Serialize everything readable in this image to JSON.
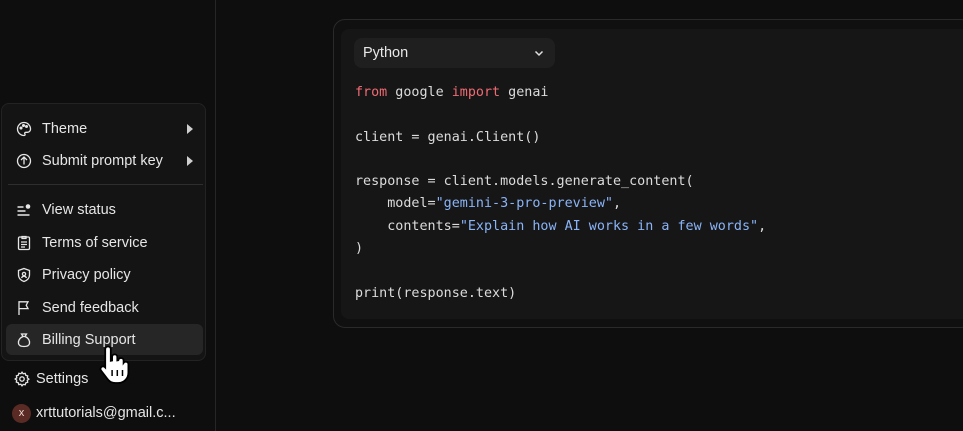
{
  "menu": {
    "items": [
      {
        "label": "Theme",
        "icon": "palette-icon",
        "submenu": true
      },
      {
        "label": "Submit prompt key",
        "icon": "arrow-up-circle-icon",
        "submenu": true
      },
      {
        "label": "View status",
        "icon": "status-icon",
        "submenu": false
      },
      {
        "label": "Terms of service",
        "icon": "document-icon",
        "submenu": false
      },
      {
        "label": "Privacy policy",
        "icon": "shield-icon",
        "submenu": false
      },
      {
        "label": "Send feedback",
        "icon": "flag-icon",
        "submenu": false
      },
      {
        "label": "Billing Support",
        "icon": "money-bag-icon",
        "submenu": false
      }
    ]
  },
  "settings": {
    "label": "Settings",
    "icon": "gear-icon"
  },
  "account": {
    "avatar_letter": "x",
    "email": "xrttutorials@gmail.c..."
  },
  "code_panel": {
    "language": "Python",
    "lines": [
      [
        {
          "t": "from",
          "c": "kw"
        },
        {
          "t": " google "
        },
        {
          "t": "import",
          "c": "kw"
        },
        {
          "t": " genai"
        }
      ],
      [],
      [
        {
          "t": "client = genai.Client()"
        }
      ],
      [],
      [
        {
          "t": "response = client.models.generate_content("
        }
      ],
      [
        {
          "t": "    model="
        },
        {
          "t": "\"gemini-3-pro-preview\"",
          "c": "str"
        },
        {
          "t": ","
        }
      ],
      [
        {
          "t": "    contents="
        },
        {
          "t": "\"Explain how AI works in a few words\"",
          "c": "str"
        },
        {
          "t": ","
        }
      ],
      [
        {
          "t": ")"
        }
      ],
      [],
      [
        {
          "t": "print(response.text)"
        }
      ]
    ]
  },
  "colors": {
    "keyword": "#ef6b73",
    "string": "#8ab4f8",
    "hover": "#262626"
  }
}
